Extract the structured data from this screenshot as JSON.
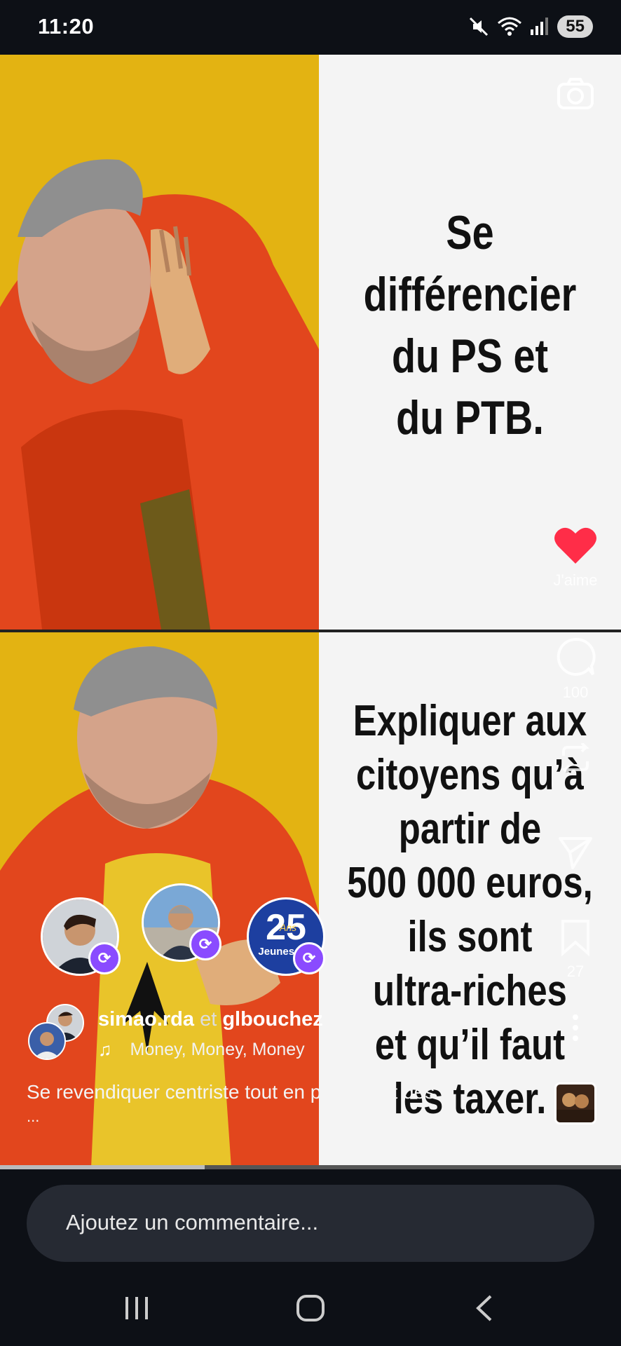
{
  "status": {
    "time": "11:20",
    "battery": "55"
  },
  "meme": {
    "top_text": "Se\ndifférencier\ndu PS et\ndu PTB.",
    "bottom_text": "Expliquer aux\ncitoyens qu’à\npartir de\n500 000 euros,\nils sont\nultra-riches\net qu’il faut\nles taxer."
  },
  "actions": {
    "like_label": "J'aime",
    "comment_count": "100",
    "save_count": "27"
  },
  "avatars": [
    {
      "name": "avatar-user-1",
      "badge": "repost-icon"
    },
    {
      "name": "avatar-user-2",
      "badge": "repost-icon"
    },
    {
      "name": "avatar-jeunes-mr",
      "badge": "repost-icon",
      "logo_number": "25",
      "logo_text": "Jeunes MR",
      "logo_sub": "Ans"
    }
  ],
  "post": {
    "author_1": "simao.rda",
    "joiner": "et",
    "author_2": "glbouchez",
    "music": "Money, Money, Money",
    "caption": "Se revendiquer centriste tout en proposant des",
    "more": "..."
  },
  "comment": {
    "placeholder": "Ajoutez un commentaire..."
  },
  "progress": {
    "fraction": 0.33
  },
  "colors": {
    "accent_heart": "#ff2d48",
    "badge": "#8a4bff",
    "photo_bg": "#e3b312"
  }
}
